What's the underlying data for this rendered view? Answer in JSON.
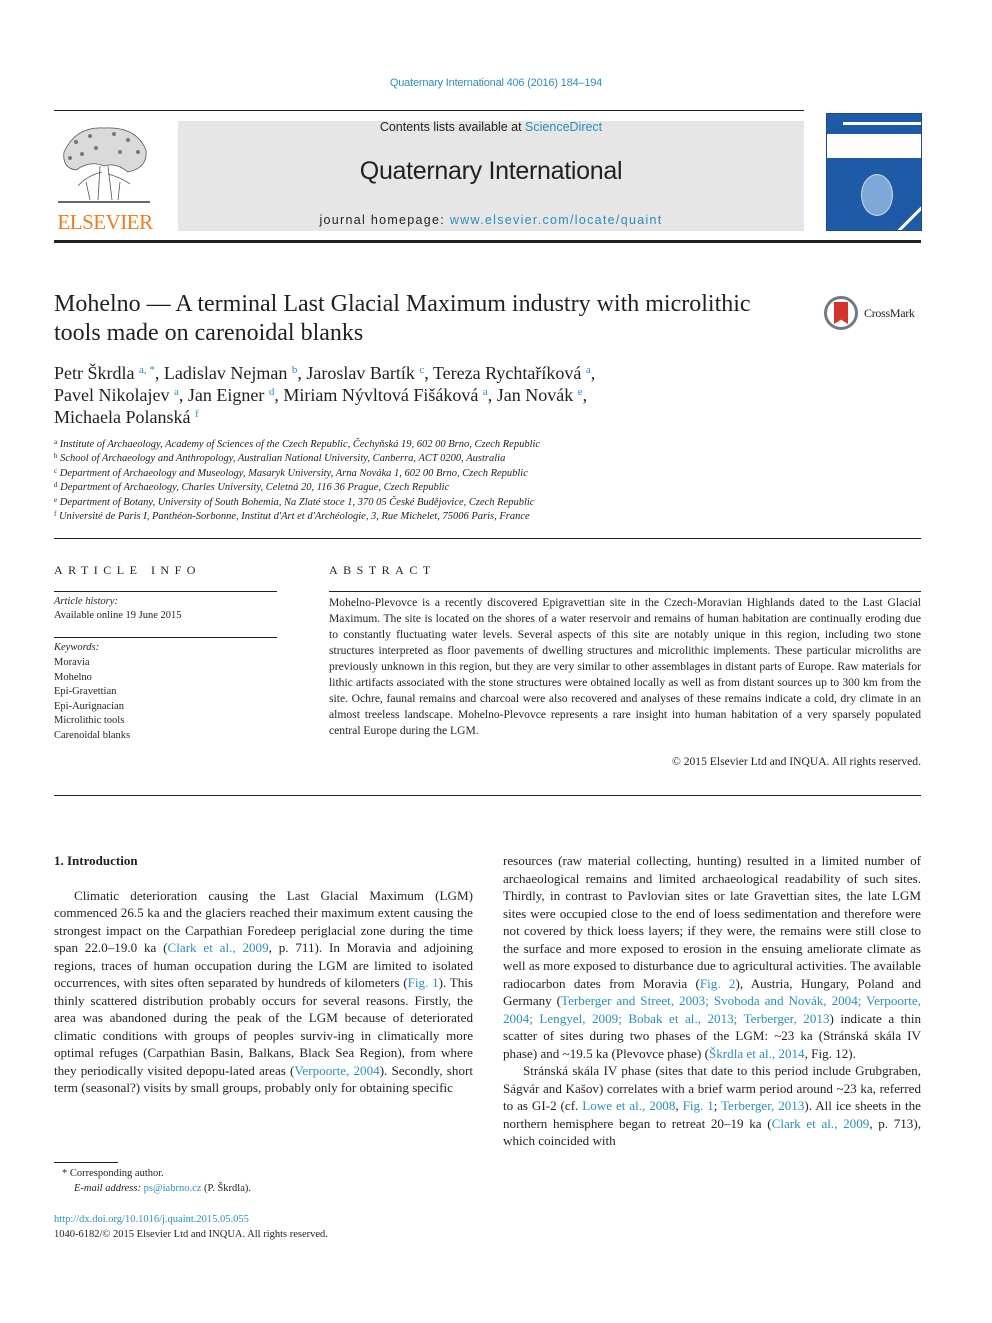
{
  "header": {
    "journal_ref": "Quaternary International 406 (2016) 184–194",
    "publisher_word": "ELSEVIER",
    "contents_prefix": "Contents lists available at ",
    "contents_link": "ScienceDirect",
    "journal_title": "Quaternary International",
    "homepage_prefix": "journal homepage: ",
    "homepage_link": "www.elsevier.com/locate/quaint"
  },
  "article": {
    "title": "Mohelno — A terminal Last Glacial Maximum industry with microlithic tools made on carenoidal blanks",
    "crossmark_label": "CrossMark",
    "authors": [
      {
        "name": "Petr Škrdla",
        "sup": "a, *",
        "sep": ", "
      },
      {
        "name": "Ladislav Nejman",
        "sup": "b",
        "sep": ", "
      },
      {
        "name": "Jaroslav Bartík",
        "sup": "c",
        "sep": ", "
      },
      {
        "name": "Tereza Rychtaříková",
        "sup": "a",
        "sep": ","
      },
      {
        "name": "Pavel Nikolajev",
        "sup": "a",
        "sep": ", "
      },
      {
        "name": "Jan Eigner",
        "sup": "d",
        "sep": ", "
      },
      {
        "name": "Miriam Nývltová Fišáková",
        "sup": "a",
        "sep": ", "
      },
      {
        "name": "Jan Novák",
        "sup": "e",
        "sep": ","
      },
      {
        "name": "Michaela Polanská",
        "sup": "f",
        "sep": ""
      }
    ],
    "affiliations": [
      {
        "key": "a",
        "text": "Institute of Archaeology, Academy of Sciences of the Czech Republic, Čechyňská 19, 602 00 Brno, Czech Republic"
      },
      {
        "key": "b",
        "text": "School of Archaeology and Anthropology, Australian National University, Canberra, ACT 0200, Australia"
      },
      {
        "key": "c",
        "text": "Department of Archaeology and Museology, Masaryk University, Arna Nováka 1, 602 00 Brno, Czech Republic"
      },
      {
        "key": "d",
        "text": "Department of Archaeology, Charles University, Celetná 20, 116 36 Prague, Czech Republic"
      },
      {
        "key": "e",
        "text": "Department of Botany, University of South Bohemia, Na Zlaté stoce 1, 370 05 České Budějovice, Czech Republic"
      },
      {
        "key": "f",
        "text": "Université de Paris I, Panthéon-Sorbonne, Institut d'Art et d'Archéologie, 3, Rue Michelet, 75006 Paris, France"
      }
    ]
  },
  "article_info": {
    "heading": "ARTICLE INFO",
    "history_label": "Article history:",
    "history_value": "Available online 19 June 2015",
    "keywords_label": "Keywords:",
    "keywords": [
      "Moravia",
      "Mohelno",
      "Epi-Gravettian",
      "Epi-Aurignacian",
      "Microlithic tools",
      "Carenoidal blanks"
    ]
  },
  "abstract": {
    "heading": "ABSTRACT",
    "text": "Mohelno-Plevovce is a recently discovered Epigravettian site in the Czech-Moravian Highlands dated to the Last Glacial Maximum. The site is located on the shores of a water reservoir and remains of human habitation are continually eroding due to constantly fluctuating water levels. Several aspects of this site are notably unique in this region, including two stone structures interpreted as floor pavements of dwelling structures and microlithic implements. These particular microliths are previously unknown in this region, but they are very similar to other assemblages in distant parts of Europe. Raw materials for lithic artifacts associated with the stone structures were obtained locally as well as from distant sources up to 300 km from the site. Ochre, faunal remains and charcoal were also recovered and analyses of these remains indicate a cold, dry climate in an almost treeless landscape. Mohelno-Plevovce represents a rare insight into human habitation of a very sparsely populated central Europe during the LGM.",
    "copyright": "© 2015 Elsevier Ltd and INQUA. All rights reserved."
  },
  "body": {
    "section_heading": "1.  Introduction",
    "left_paragraph": [
      {
        "t": "Climatic deterioration causing the Last Glacial Maximum (LGM) commenced 26.5 ka and the glaciers reached their maximum extent causing the strongest impact on the Carpathian Foredeep periglacial zone during the time span 22.0–19.0 ka (",
        "link": false
      },
      {
        "t": "Clark et al., 2009",
        "link": true
      },
      {
        "t": ", p. 711). In Moravia and adjoining regions, traces of human occupation during the LGM are limited to isolated occurrences, with sites often separated by hundreds of kilometers (",
        "link": false
      },
      {
        "t": "Fig. 1",
        "link": true
      },
      {
        "t": "). This thinly scattered distribution probably occurs for several reasons. Firstly, the area was abandoned during the peak of the LGM because of deteriorated climatic conditions with groups of peoples surviv-ing in climatically more optimal refuges (Carpathian Basin, Balkans, Black Sea Region), from where they periodically visited depopu-lated areas (",
        "link": false
      },
      {
        "t": "Verpoorte, 2004",
        "link": true
      },
      {
        "t": "). Secondly, short term (seasonal?) visits by small groups, probably only for obtaining specific",
        "link": false
      }
    ],
    "right_paragraph_1": [
      {
        "t": "resources (raw material collecting, hunting) resulted in a limited number of archaeological remains and limited archaeological readability of such sites. Thirdly, in contrast to Pavlovian sites or late Gravettian sites, the late LGM sites were occupied close to the end of loess sedimentation and therefore were not covered by thick loess layers; if they were, the remains were still close to the surface and more exposed to erosion in the ensuing ameliorate climate as well as more exposed to disturbance due to agricultural activities. The available radiocarbon dates from Moravia (",
        "link": false
      },
      {
        "t": "Fig. 2",
        "link": true
      },
      {
        "t": "), Austria, Hungary, Poland and Germany (",
        "link": false
      },
      {
        "t": "Terberger and Street, 2003; Svoboda and Novák, 2004; Verpoorte, 2004; Lengyel, 2009; Bobak et al., 2013; Terberger, 2013",
        "link": true
      },
      {
        "t": ") indicate a thin scatter of sites during two phases of the LGM: ~23 ka (Stránská skála IV phase) and ~19.5 ka (Plevovce phase) (",
        "link": false
      },
      {
        "t": "Škrdla et al., 2014",
        "link": true
      },
      {
        "t": ", Fig. 12).",
        "link": false
      }
    ],
    "right_paragraph_2": [
      {
        "t": "Stránská skála IV phase (sites that date to this period include Grubgraben, Ságvár and Kašov) correlates with a brief warm period around ~23 ka, referred to as GI-2 (cf. ",
        "link": false
      },
      {
        "t": "Lowe et al., 2008",
        "link": true
      },
      {
        "t": ", ",
        "link": false
      },
      {
        "t": "Fig. 1",
        "link": true
      },
      {
        "t": "; ",
        "link": false
      },
      {
        "t": "Terberger, 2013",
        "link": true
      },
      {
        "t": "). All ice sheets in the northern hemisphere began to retreat 20–19 ka (",
        "link": false
      },
      {
        "t": "Clark et al., 2009",
        "link": true
      },
      {
        "t": ", p. 713), which coincided with",
        "link": false
      }
    ]
  },
  "footnotes": {
    "corresponding": "*  Corresponding author.",
    "email_label": "E-mail address:",
    "email": "ps@iabrno.cz",
    "email_suffix": " (P. Škrdla).",
    "doi": "http://dx.doi.org/10.1016/j.quaint.2015.05.055",
    "issn_copyright": "1040-6182/© 2015 Elsevier Ltd and INQUA. All rights reserved."
  },
  "colors": {
    "link": "#2a8fbd",
    "elsevier_orange": "#f07c1c",
    "banner_gray": "#e6e6e6",
    "cover_blue": "#1f5aa6",
    "crossmark_red": "#d1352b"
  }
}
